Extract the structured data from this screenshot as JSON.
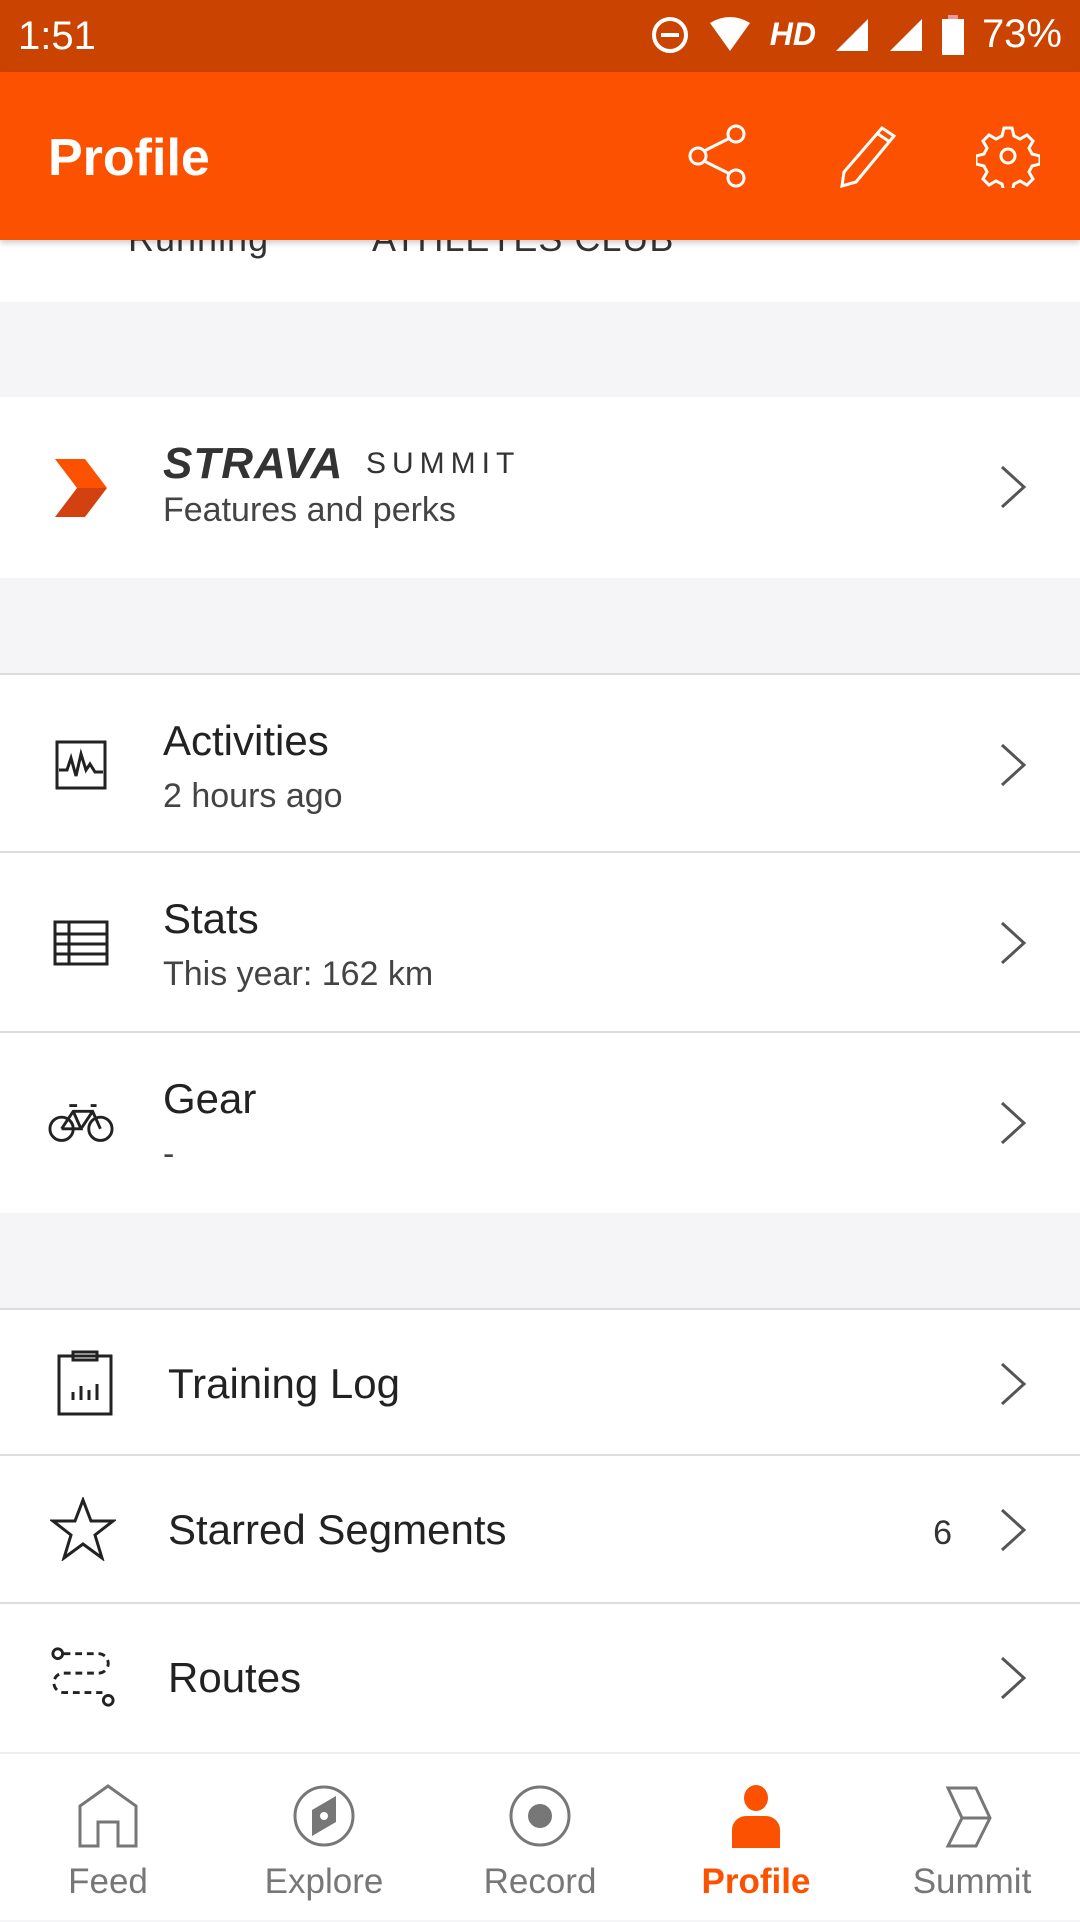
{
  "status_bar": {
    "time": "1:51",
    "network": "HD",
    "battery": "73%"
  },
  "app_bar": {
    "title": "Profile",
    "actions": [
      "share-icon",
      "edit-icon",
      "settings-icon"
    ]
  },
  "clipped_row": {
    "left": "Running",
    "right": "ATHLETES CLUB"
  },
  "summit": {
    "brand": "STRAVA",
    "product": "SUMMIT",
    "subtitle": "Features and perks"
  },
  "items": [
    {
      "title": "Activities",
      "subtitle": "2 hours ago",
      "icon": "activity-chart-icon"
    },
    {
      "title": "Stats",
      "subtitle": "This year: 162 km",
      "icon": "table-icon"
    },
    {
      "title": "Gear",
      "subtitle": "-",
      "icon": "bike-icon"
    }
  ],
  "links": [
    {
      "title": "Training Log",
      "icon": "clipboard-chart-icon"
    },
    {
      "title": "Starred Segments",
      "count": "6",
      "icon": "star-icon"
    },
    {
      "title": "Routes",
      "icon": "route-icon"
    }
  ],
  "nav": [
    {
      "label": "Feed",
      "icon": "home-icon"
    },
    {
      "label": "Explore",
      "icon": "compass-icon"
    },
    {
      "label": "Record",
      "icon": "record-icon"
    },
    {
      "label": "Profile",
      "icon": "person-icon",
      "active": true
    },
    {
      "label": "Summit",
      "icon": "summit-icon"
    }
  ],
  "colors": {
    "accent": "#fc5200",
    "status_bar": "#cb4300"
  }
}
